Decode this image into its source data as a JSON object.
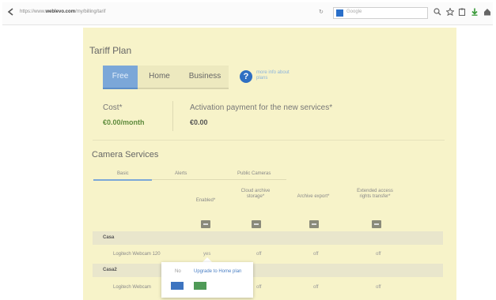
{
  "browser": {
    "url_prefix": "https://www.",
    "url_domain": "weblevo.com",
    "url_path": "/my/billing/tarif",
    "search_placeholder": "Google"
  },
  "tariff": {
    "heading": "Tariff Plan",
    "tabs": [
      "Free",
      "Home",
      "Business"
    ],
    "more_info": "more info about plans",
    "cost_label": "Cost",
    "cost_value": "€0.00/month",
    "activation_label": "Activation payment for the new services",
    "activation_value": "€0.00"
  },
  "camera": {
    "heading": "Camera Services",
    "subtabs": [
      "Basic",
      "Alerts",
      "Public Cameras"
    ],
    "columns": [
      "Enabled",
      "Cloud archive storage",
      "Archive export",
      "Extended access rights transfer"
    ],
    "groups": [
      {
        "label": "Casa",
        "camera": "Logitech Webcam 120",
        "cells": [
          "yes",
          "off",
          "off",
          "off"
        ]
      },
      {
        "label": "Casa2",
        "camera": "Logitech Webcam",
        "cells": [
          "",
          "off",
          "off",
          "off"
        ]
      }
    ]
  },
  "popup": {
    "no_text": "No",
    "upgrade_text": "Upgrade to Home plan"
  },
  "colors": {
    "panel": "#f7f3c9",
    "active_tab": "#7ba7d8",
    "cost_green": "#5d8a3b",
    "link_blue": "#4a7fc4"
  }
}
